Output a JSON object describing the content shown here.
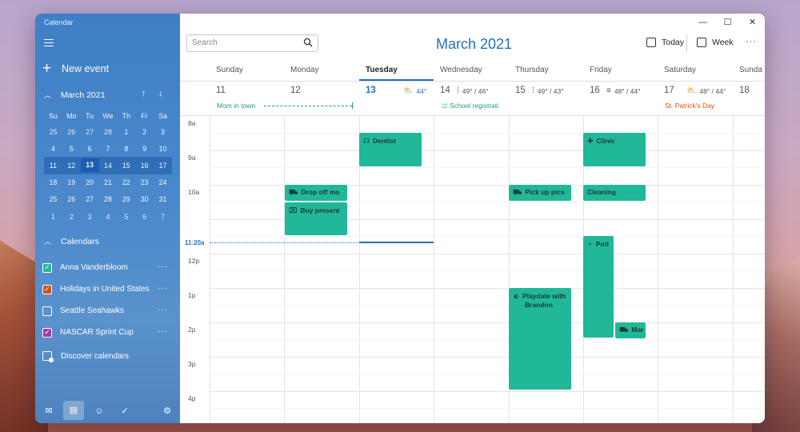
{
  "sidebar": {
    "app_title": "Calendar",
    "new_event_label": "New event",
    "mini_month": "March 2021",
    "weekdays": [
      "Su",
      "Mo",
      "Tu",
      "We",
      "Th",
      "Fr",
      "Sa"
    ],
    "weeks": [
      [
        "25",
        "26",
        "27",
        "28",
        "1",
        "2",
        "3"
      ],
      [
        "4",
        "5",
        "6",
        "7",
        "8",
        "9",
        "10"
      ],
      [
        "11",
        "12",
        "13",
        "14",
        "15",
        "16",
        "17"
      ],
      [
        "18",
        "19",
        "20",
        "21",
        "22",
        "23",
        "24"
      ],
      [
        "25",
        "26",
        "27",
        "28",
        "29",
        "30",
        "31"
      ],
      [
        "1",
        "2",
        "3",
        "4",
        "5",
        "6",
        "7"
      ]
    ],
    "calendars_header": "Calendars",
    "calendars": [
      {
        "name": "Anna Vanderbloom",
        "color": "#21b89a",
        "checked": true
      },
      {
        "name": "Holidays in United States",
        "color": "#d2530c",
        "checked": true
      },
      {
        "name": "Seattle Seahawks",
        "color": "#ffffff",
        "checked": false
      },
      {
        "name": "NASCAR Sprint Cup",
        "color": "#a23aa8",
        "checked": true
      }
    ],
    "discover_label": "Discover calendars"
  },
  "toolbar": {
    "search_placeholder": "Search",
    "month_title": "March 2021",
    "today_label": "Today",
    "week_label": "Week"
  },
  "days": [
    {
      "name": "Sunday",
      "date": "11",
      "weather": "",
      "allday": "Mom in town"
    },
    {
      "name": "Monday",
      "date": "12",
      "weather": "",
      "allday": ""
    },
    {
      "name": "Tuesday",
      "date": "13",
      "weather": "44°",
      "allday": ""
    },
    {
      "name": "Wednesday",
      "date": "14",
      "weather": "49° / 46°",
      "allday": "School registrati"
    },
    {
      "name": "Thursday",
      "date": "15",
      "weather": "49° / 43°",
      "allday": ""
    },
    {
      "name": "Friday",
      "date": "16",
      "weather": "48° / 44°",
      "allday": ""
    },
    {
      "name": "Saturday",
      "date": "17",
      "weather": "48° / 44°",
      "allday": "St. Patrick's Day"
    },
    {
      "name": "Sunda",
      "date": "18",
      "weather": "",
      "allday": ""
    }
  ],
  "times": [
    "8a",
    "9a",
    "10a",
    "11a",
    "12p",
    "1p",
    "2p",
    "3p",
    "4p"
  ],
  "now_label": "11:20a",
  "events": {
    "dentist": "Dentist",
    "clinic": "Clinic",
    "drop_off": "Drop off mo",
    "buy_present": "Buy present",
    "pick_up": "Pick up pics",
    "cleaning": "Cleaning",
    "potl": "Potl",
    "playdate": "Playdate with Brandon",
    "mar": "Mar"
  },
  "colors": {
    "accent": "#1f6fc4",
    "event": "#21b89a",
    "holiday": "#d2530c"
  }
}
